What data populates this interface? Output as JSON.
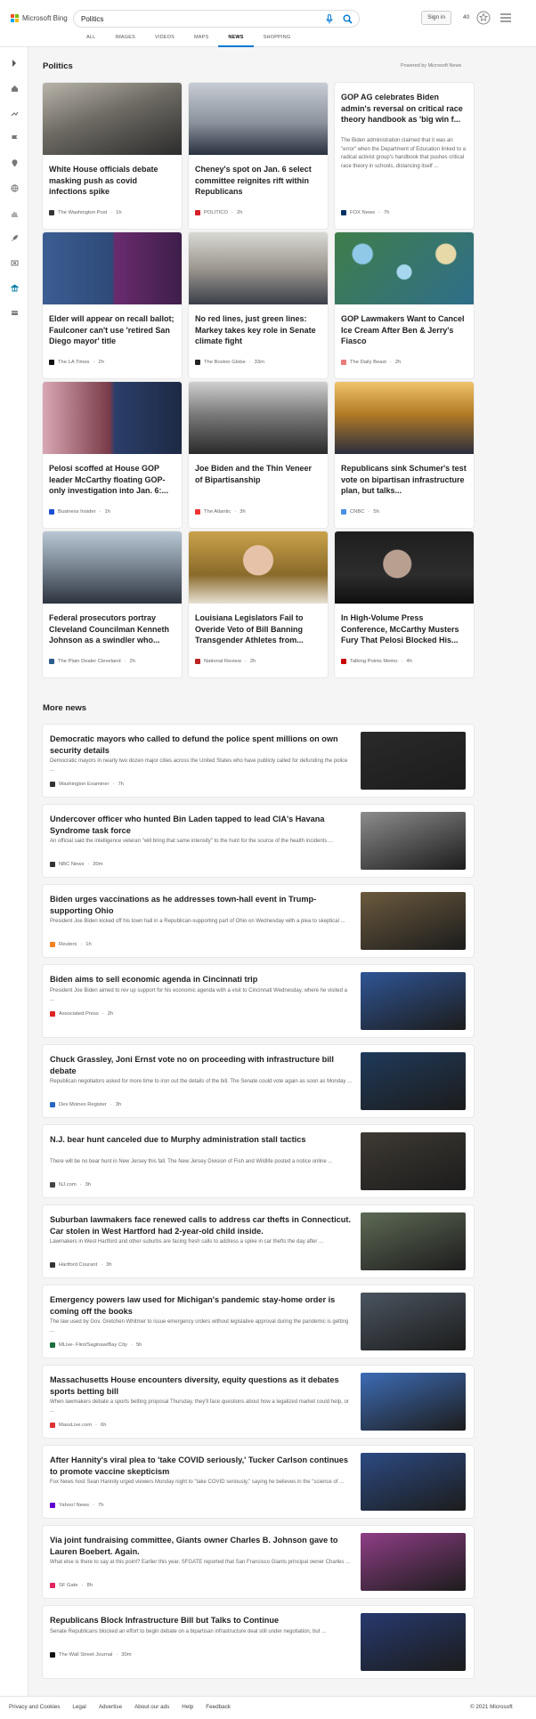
{
  "header": {
    "brand": "Microsoft Bing",
    "query": "Politics",
    "signin": "Sign in",
    "points": "40",
    "icons": [
      "mic-icon",
      "search-icon",
      "rewards-icon",
      "hamburger-menu-icon"
    ],
    "tabs": [
      "ALL",
      "IMAGES",
      "VIDEOS",
      "MAPS",
      "NEWS",
      "SHOPPING"
    ],
    "active_tab": "NEWS"
  },
  "rail": [
    "collapse-arrow-icon",
    "home-icon",
    "trending-icon",
    "flag-icon",
    "location-pin-icon",
    "globe-icon",
    "chart-icon",
    "rocket-icon",
    "film-icon",
    "building-icon",
    "card-icon"
  ],
  "top": {
    "title": "Politics",
    "powered": "Powered by Microsoft News",
    "cards": [
      {
        "title": "White House officials debate masking push as covid infections spike",
        "source": "The Washington Post",
        "time": "1h",
        "color": "#3a3a3a",
        "favicon": "#333"
      },
      {
        "title": "Cheney's spot on Jan. 6 select committee reignites rift within Republicans",
        "source": "POLITICO",
        "time": "2h",
        "color": "#8a8e95",
        "favicon": "#d61f26"
      },
      {
        "title": "GOP AG celebrates Biden admin's reversal on critical race theory handbook as 'big win f...",
        "snippet": "The Biden administration claimed that it was an \"error\" when the Department of Education linked to a radical activist group's handbook that pushes critical race theory in schools, distancing itself ...",
        "source": "FOX News",
        "time": "7h",
        "color": "",
        "favicon": "#003366"
      },
      {
        "title": "Elder will appear on recall ballot; Faulconer can't use 'retired San Diego mayor' title",
        "source": "The LA Times",
        "time": "2h",
        "color": "#2e4a78",
        "favicon": "#111"
      },
      {
        "title": "No red lines, just green lines: Markey takes key role in Senate climate fight",
        "source": "The Boston Globe",
        "time": "33m",
        "color": "#5a5f66",
        "favicon": "#222"
      },
      {
        "title": "GOP Lawmakers Want to Cancel Ice Cream After Ben & Jerry's Fiasco",
        "source": "The Daily Beast",
        "time": "2h",
        "color": "#3f7e4a",
        "favicon": "#e87b7b"
      },
      {
        "title": "Pelosi scoffed at House GOP leader McCarthy floating GOP-only investigation into Jan. 6:...",
        "source": "Business Insider",
        "time": "1h",
        "color": "#5b2e36",
        "favicon": "#1a4fd6"
      },
      {
        "title": "Joe Biden and the Thin Veneer of Bipartisanship",
        "source": "The Atlantic",
        "time": "3h",
        "color": "#6d6d6d",
        "favicon": "#e33"
      },
      {
        "title": "Republicans sink Schumer's test vote on bipartisan infrastructure plan, but talks...",
        "source": "CNBC",
        "time": "5h",
        "color": "#9c6b1f",
        "favicon": "#4a90e2"
      },
      {
        "title": "Federal prosecutors portray Cleveland Councilman Kenneth Johnson as a swindler who...",
        "source": "The Plain Dealer Cleveland",
        "time": "2h",
        "color": "#4e5d6d",
        "favicon": "#2b5e8c"
      },
      {
        "title": "Louisiana Legislators Fail to Overide Veto of Bill Banning Transgender Athletes from...",
        "source": "National Review",
        "time": "2h",
        "color": "#8a6a2a",
        "favicon": "#b22"
      },
      {
        "title": "In High-Volume Press Conference, McCarthy Musters Fury That Pelosi Blocked His...",
        "source": "Talking Points Memo",
        "time": "4h",
        "color": "#1e1e1e",
        "favicon": "#c00"
      }
    ]
  },
  "more": {
    "title": "More news",
    "items": [
      {
        "title": "Democratic mayors who called to defund the police spent millions on own security details",
        "snippet": "Democratic mayors in nearly two dozen major cities across the United States who have publicly called for defunding the police ...",
        "source": "Washington Examiner",
        "time": "7h",
        "color": "#2a2a2a",
        "favicon": "#333"
      },
      {
        "title": "Undercover officer who hunted Bin Laden tapped to lead CIA's Havana Syndrome task force",
        "snippet": "An official said the intelligence veteran \"will bring that same intensity\" to the hunt for the source of the health incidents ...",
        "source": "NBC News",
        "time": "30m",
        "color": "#8c8c8c",
        "favicon": "#333"
      },
      {
        "title": "Biden urges vaccinations as he addresses town-hall event in Trump-supporting Ohio",
        "snippet": "President Joe Biden kicked off his town hall in a Republican-supporting part of Ohio on Wednesday with a plea to skeptical ...",
        "source": "Reuters",
        "time": "1h",
        "color": "#6b5a3e",
        "favicon": "#f58220"
      },
      {
        "title": "Biden aims to sell economic agenda in Cincinnati trip",
        "snippet": "President Joe Biden aimed to rev up support for his economic agenda with a visit to Cincinnati Wednesday, where he visited a ...",
        "source": "Associated Press",
        "time": "2h",
        "color": "#2f5595",
        "favicon": "#d22"
      },
      {
        "title": "Chuck Grassley, Joni Ernst vote no on proceeding with infrastructure bill debate",
        "snippet": "Republican negotiators asked for more time to iron out the details of the bill. The Senate could vote again as soon as Monday ...",
        "source": "Des Moines Register",
        "time": "3h",
        "color": "#1f3a5a",
        "favicon": "#2a66c4"
      },
      {
        "title": "N.J. bear hunt canceled due to Murphy administration stall tactics",
        "snippet": "There will be no bear hunt in New Jersey this fall. The New Jersey Division of Fish and Wildlife posted a notice online ...",
        "source": "NJ.com",
        "time": "3h",
        "color": "#3e3a33",
        "favicon": "#444"
      },
      {
        "title": "Suburban lawmakers face renewed calls to address car thefts in Connecticut. Car stolen in West Hartford had 2-year-old child inside.",
        "snippet": "Lawmakers in West Hartford and other suburbs are facing fresh calls to address a spike in car thefts the day after ...",
        "source": "Hartford Courant",
        "time": "3h",
        "color": "#5e6a55",
        "favicon": "#333"
      },
      {
        "title": "Emergency powers law used for Michigan's pandemic stay-home order is coming off the books",
        "snippet": "The law used by Gov. Gretchen Whitmer to issue emergency orders without legislative approval during the pandemic is getting ...",
        "source": "MLive- Flint/Saginaw/Bay City",
        "time": "5h",
        "color": "#4a5560",
        "favicon": "#1b6e3c"
      },
      {
        "title": "Massachusetts House encounters diversity, equity questions as it debates sports betting bill",
        "snippet": "When lawmakers debate a sports betting proposal Thursday, they'll face questions about how a legalized market could help, or ...",
        "source": "MassLive.com",
        "time": "6h",
        "color": "#3d6cb5",
        "favicon": "#d33"
      },
      {
        "title": "After Hannity's viral plea to 'take COVID seriously,' Tucker Carlson continues to promote vaccine skepticism",
        "snippet": "Fox News host Sean Hannity urged viewers Monday night to \"take COVID seriously,\" saying he believes in the \"science of ...",
        "source": "Yahoo! News",
        "time": "7h",
        "color": "#2c4a82",
        "favicon": "#6001d2"
      },
      {
        "title": "Via joint fundraising committee, Giants owner Charles B. Johnson gave to Lauren Boebert. Again.",
        "snippet": "What else is there to say at this point? Earlier this year, SFGATE reported that San Francisco Giants principal owner Charles ...",
        "source": "SF Gate",
        "time": "8h",
        "color": "#8f3e86",
        "favicon": "#e0245e"
      },
      {
        "title": "Republicans Block Infrastructure Bill but Talks to Continue",
        "snippet": "Senate Republicans blocked an effort to begin debate on a bipartisan infrastructure deal still under negotiation, but ...",
        "source": "The Wall Street Journal",
        "time": "30m",
        "color": "#27396e",
        "favicon": "#111"
      }
    ]
  },
  "footer": {
    "links": [
      "Privacy and Cookies",
      "Legal",
      "Advertise",
      "About our ads",
      "Help",
      "Feedback"
    ],
    "copyright": "© 2021 Microsoft"
  }
}
